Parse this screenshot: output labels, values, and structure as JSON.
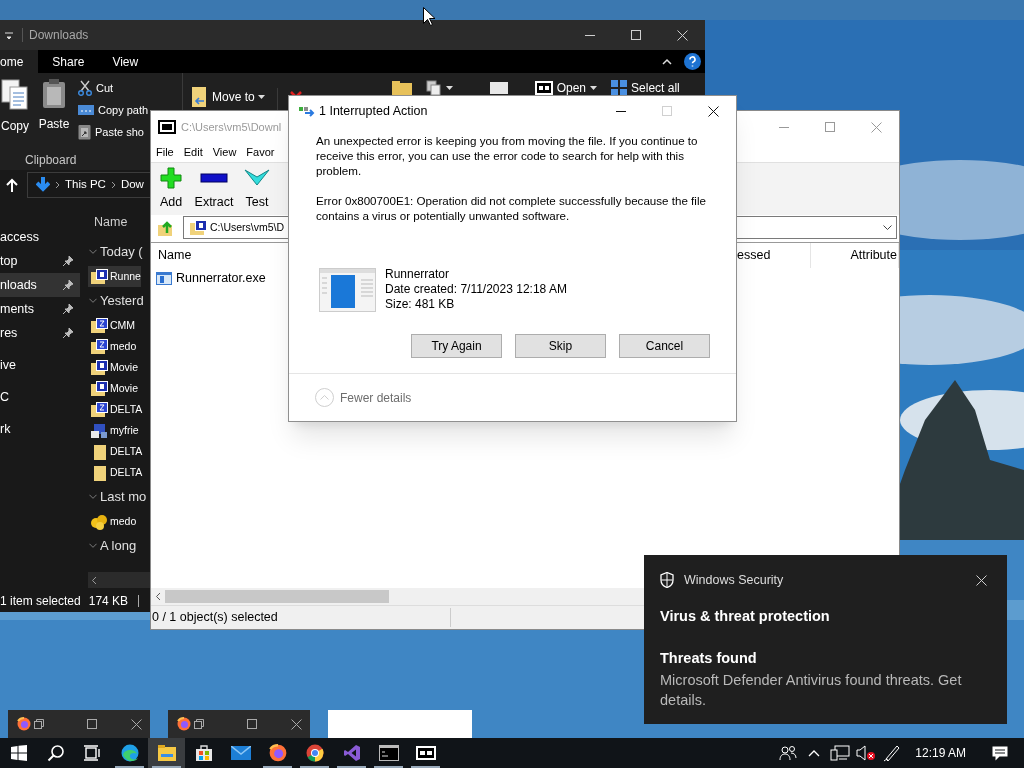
{
  "explorer": {
    "title": "Downloads",
    "ribbon_tabs": [
      {
        "label": "ome",
        "selected": true
      },
      {
        "label": "Share",
        "selected": false
      },
      {
        "label": "View",
        "selected": false
      }
    ],
    "clipboard": {
      "large": [
        {
          "label": "Copy",
          "kind": "copy"
        },
        {
          "label": "Paste",
          "kind": "paste"
        }
      ],
      "small": [
        {
          "label": "Cut",
          "kind": "cut"
        },
        {
          "label": "Copy path",
          "kind": "copy-path"
        },
        {
          "label": "Paste sho",
          "kind": "paste-shortcut"
        }
      ],
      "group_label": "Clipboard"
    },
    "organize": [
      {
        "label": "Move to",
        "kind": "move",
        "caret": true
      },
      {
        "kind": "delete",
        "caret": false
      }
    ],
    "top_tools": [
      {
        "kind": "new-folder",
        "caret": false
      },
      {
        "kind": "new-item",
        "caret": true
      },
      {
        "kind": "properties",
        "caret": false
      },
      {
        "kind": "open",
        "label": "Open",
        "caret": true
      },
      {
        "kind": "select-all",
        "label": "Select all",
        "caret": false
      }
    ],
    "breadcrumb": [
      "This PC",
      "Dow"
    ],
    "nav_sections": [
      {
        "items": [
          {
            "label": "access",
            "selected": false,
            "pinned": false
          },
          {
            "label": "top",
            "selected": false,
            "pinned": true
          },
          {
            "label": "nloads",
            "selected": true,
            "pinned": true
          },
          {
            "label": "ments",
            "selected": false,
            "pinned": true
          },
          {
            "label": "res",
            "selected": false,
            "pinned": true
          }
        ]
      },
      {
        "items": [
          {
            "label": "ive",
            "selected": false,
            "pinned": false
          }
        ]
      },
      {
        "items": [
          {
            "label": "C",
            "selected": false,
            "pinned": false
          }
        ]
      },
      {
        "items": [
          {
            "label": "rk",
            "selected": false,
            "pinned": false
          }
        ]
      }
    ],
    "list_header": "Name",
    "groups": [
      {
        "label": "Today (",
        "items": [
          {
            "name": "Runne",
            "kind": "rar",
            "selected": true
          }
        ]
      },
      {
        "label": "Yesterd",
        "items": [
          {
            "name": "CMM",
            "kind": "zip",
            "selected": false
          },
          {
            "name": "medo",
            "kind": "zip",
            "selected": false
          },
          {
            "name": "Movie",
            "kind": "rar",
            "selected": false
          },
          {
            "name": "Movie",
            "kind": "rar",
            "selected": false
          },
          {
            "name": "DELTA",
            "kind": "zip",
            "selected": false
          },
          {
            "name": "myfrie",
            "kind": "exe",
            "selected": false
          },
          {
            "name": "DELTA",
            "kind": "folder",
            "selected": false
          },
          {
            "name": "DELTA",
            "kind": "folder",
            "selected": false
          }
        ]
      },
      {
        "label": "Last mo",
        "items": [
          {
            "name": "medo",
            "kind": "app",
            "selected": false
          }
        ]
      },
      {
        "label": "A long"
      }
    ],
    "status": {
      "selection": "1 item selected",
      "size": "174 KB"
    }
  },
  "sevenzip": {
    "title": "C:\\Users\\vm5\\Downl",
    "menu": [
      "File",
      "Edit",
      "View",
      "Favor"
    ],
    "tools": [
      {
        "label": "Add",
        "kind": "add"
      },
      {
        "label": "Extract",
        "kind": "extract"
      },
      {
        "label": "Test",
        "kind": "test"
      }
    ],
    "path": "C:\\Users\\vm5\\D",
    "columns": [
      "Name",
      "essed",
      "Attribute"
    ],
    "rows": [
      {
        "name": "Runnerrator.exe"
      }
    ],
    "status": "0 / 1 object(s) selected"
  },
  "dialog": {
    "title": "1 Interrupted Action",
    "title_buttons": [
      {
        "kind": "minimize",
        "disabled": false
      },
      {
        "kind": "maximize",
        "disabled": true
      },
      {
        "kind": "close",
        "disabled": false
      }
    ],
    "message": "An unexpected error is keeping you from moving the file. If you continue to receive this error, you can use the error code to search for help with this problem.",
    "error": "Error 0x800700E1: Operation did not complete successfully because the file contains a virus or potentially unwanted software.",
    "file": {
      "name": "Runnerrator",
      "date": "Date created: 7/11/2023 12:18 AM",
      "size": "Size: 481 KB"
    },
    "buttons": [
      "Try Again",
      "Skip",
      "Cancel"
    ],
    "details_toggle": "Fewer details"
  },
  "toast": {
    "app": "Windows Security",
    "heading": "Virus & threat protection",
    "title": "Threats found",
    "body": "Microsoft Defender Antivirus found threats. Get details."
  },
  "previews": [
    {
      "kind": "window"
    },
    {
      "kind": "window"
    },
    {
      "kind": "blank"
    }
  ],
  "taskbar": {
    "apps": [
      {
        "kind": "start",
        "running": false,
        "active": false
      },
      {
        "kind": "search",
        "running": false,
        "active": false
      },
      {
        "kind": "task-view",
        "running": false,
        "active": false
      },
      {
        "kind": "edge",
        "running": true,
        "active": false
      },
      {
        "kind": "explorer",
        "running": true,
        "active": true
      },
      {
        "kind": "store",
        "running": false,
        "active": false
      },
      {
        "kind": "mail",
        "running": false,
        "active": false
      },
      {
        "kind": "firefox",
        "running": true,
        "active": false
      },
      {
        "kind": "chrome",
        "running": true,
        "active": false
      },
      {
        "kind": "visual-studio",
        "running": true,
        "active": false
      },
      {
        "kind": "terminal",
        "running": true,
        "active": false
      },
      {
        "kind": "archiver",
        "running": true,
        "active": false
      }
    ],
    "tray": [
      {
        "kind": "people"
      },
      {
        "kind": "chevron"
      },
      {
        "kind": "network"
      },
      {
        "kind": "volume-muted"
      },
      {
        "kind": "pen"
      }
    ],
    "clock": "12:19 AM"
  }
}
